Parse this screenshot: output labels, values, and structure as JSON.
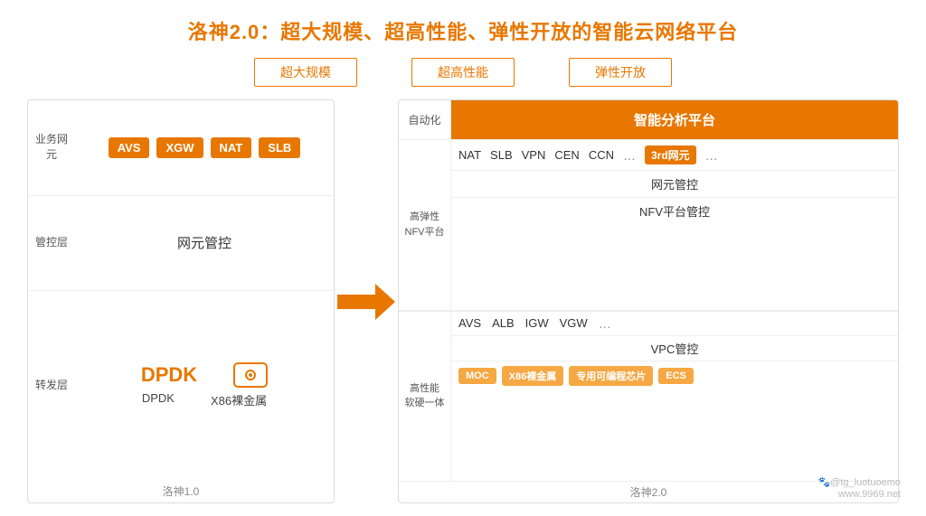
{
  "title": "洛神2.0：超大规模、超高性能、弹性开放的智能云网络平台",
  "tags": [
    "超大规模",
    "超高性能",
    "弹性开放"
  ],
  "left": {
    "rows": [
      {
        "label": "业务网元",
        "type": "orange-tags",
        "tags": [
          "AVS",
          "XGW",
          "NAT",
          "SLB"
        ]
      },
      {
        "label": "管控层",
        "type": "center-text",
        "text": "网元管控"
      },
      {
        "label": "转发层",
        "type": "dpdk",
        "dpdk_main": "DPDK",
        "dpdk_sub1": "DPDK",
        "dpdk_sub2": "X86裸金属"
      }
    ],
    "bottom_label": "洛神1.0"
  },
  "right": {
    "auto_label": "自动化",
    "auto_content": "智能分析平台",
    "elastic_label_line1": "高弹性",
    "elastic_label_line2": "NFV平台",
    "elastic_tags": [
      "NAT",
      "SLB",
      "VPN",
      "CEN",
      "CCN",
      "…"
    ],
    "elastic_3rd": "3rd网元",
    "elastic_dots2": "…",
    "elastic_control1": "网元管控",
    "elastic_control2": "NFV平台管控",
    "perf_label_line1": "高性能",
    "perf_label_line2": "软硬一体",
    "perf_tags": [
      "AVS",
      "ALB",
      "IGW",
      "VGW",
      "…"
    ],
    "vpc_label": "VPC管控",
    "hw_tags": [
      "MOC",
      "X86裸金属",
      "专用可编程芯片",
      "ECS"
    ],
    "bottom_label": "洛神2.0"
  },
  "watermark_line1": "🐾@tg_luotuoemo",
  "watermark_line2": "www.9969.net"
}
